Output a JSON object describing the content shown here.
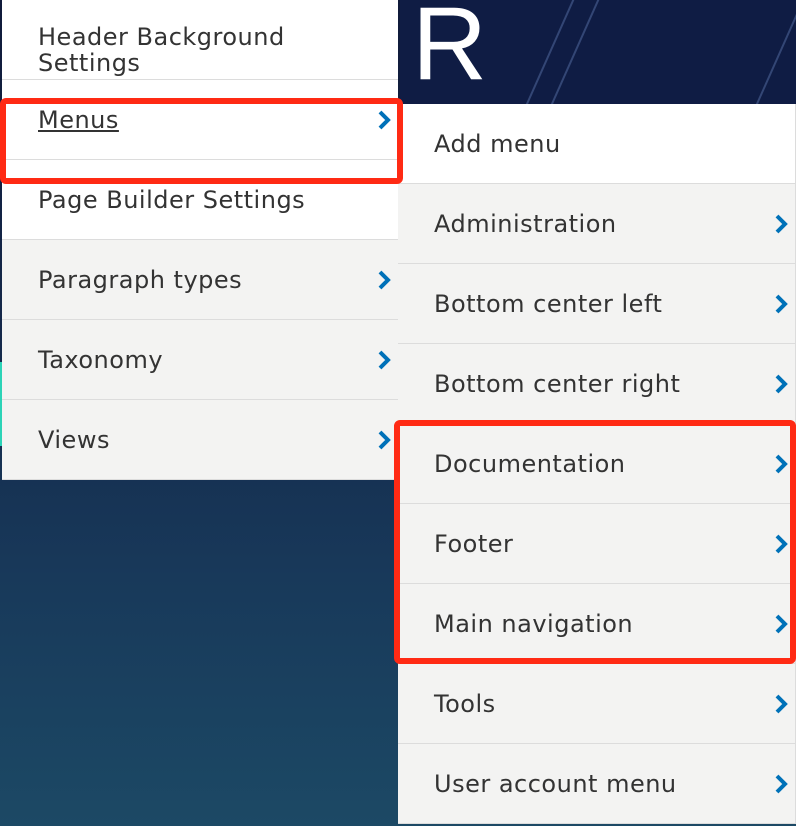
{
  "colors": {
    "menu_bg": "#f3f3f2",
    "menu_bg_white": "#ffffff",
    "text": "#333333",
    "chevron": "#0071b8",
    "highlight": "#ff2a14",
    "hero": "#0f1c44"
  },
  "hero": {
    "letter": "R"
  },
  "left_menu": {
    "items": [
      {
        "label": "Header Background Settings",
        "has_submenu": false,
        "icon": "chevron-right-icon"
      },
      {
        "label": "Menus",
        "has_submenu": true,
        "active": true,
        "highlighted": true,
        "icon": "chevron-right-icon"
      },
      {
        "label": "Page Builder Settings",
        "has_submenu": false,
        "icon": "chevron-right-icon"
      },
      {
        "label": "Paragraph types",
        "has_submenu": true,
        "icon": "chevron-right-icon"
      },
      {
        "label": "Taxonomy",
        "has_submenu": true,
        "icon": "chevron-right-icon"
      },
      {
        "label": "Views",
        "has_submenu": true,
        "icon": "chevron-right-icon"
      }
    ]
  },
  "right_menu": {
    "items": [
      {
        "label": "Add menu",
        "has_submenu": false
      },
      {
        "label": "Administration",
        "has_submenu": true
      },
      {
        "label": "Bottom center left",
        "has_submenu": true
      },
      {
        "label": "Bottom center right",
        "has_submenu": true
      },
      {
        "label": "Documentation",
        "has_submenu": true,
        "highlighted": true
      },
      {
        "label": "Footer",
        "has_submenu": true,
        "highlighted": true
      },
      {
        "label": "Main navigation",
        "has_submenu": true,
        "highlighted": true
      },
      {
        "label": "Tools",
        "has_submenu": true
      },
      {
        "label": "User account menu",
        "has_submenu": true
      }
    ]
  }
}
